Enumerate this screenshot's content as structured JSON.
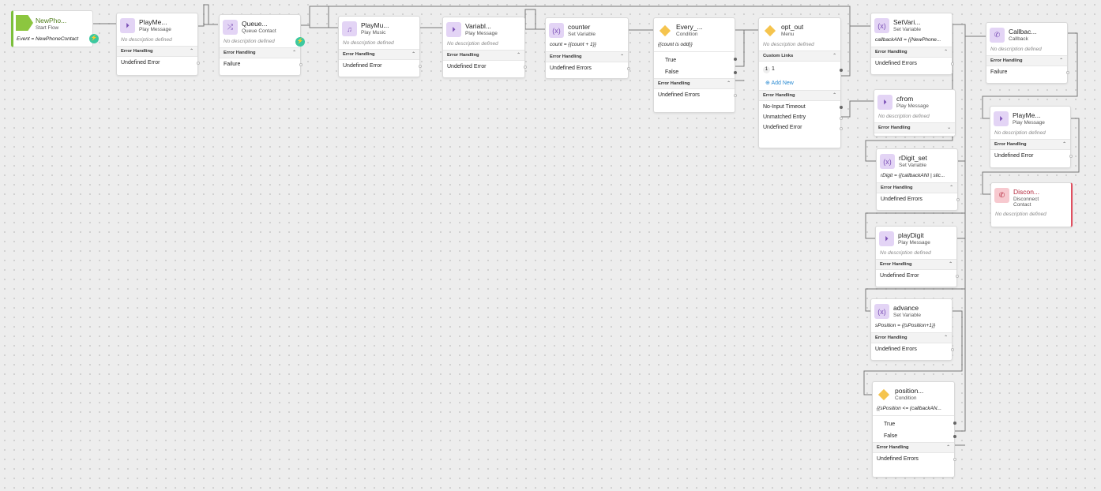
{
  "start": {
    "title": "NewPho...",
    "subtitle": "Start Flow",
    "event": "Event = NewPhoneContact"
  },
  "icons": {
    "play": "play-circle-icon",
    "queue": "shuffle-icon",
    "music": "music-note-icon",
    "variable": "variable-x-icon",
    "condition": "condition-diamond-icon",
    "menu": "menu-list-icon",
    "callback": "phone-callback-icon",
    "disconnect": "phone-disconnect-icon",
    "bolt": "bolt-icon"
  },
  "colors": {
    "start": "#8cc63f",
    "activity": "#e3d4f5",
    "condition": "#f5c44e",
    "disconnect": "#e05060",
    "link": "#2a8bd2"
  },
  "nodes": {
    "play1": {
      "title": "PlayMe...",
      "sub": "Play Message",
      "desc": "No description defined",
      "err": "Error Handling",
      "e1": "Undefined Error"
    },
    "queue": {
      "title": "Queue...",
      "sub": "Queue Contact",
      "desc": "No description defined",
      "err": "Error Handling",
      "e1": "Failure"
    },
    "music": {
      "title": "PlayMu...",
      "sub": "Play Music",
      "desc": "No description defined",
      "err": "Error Handling",
      "e1": "Undefined Error"
    },
    "varmsg": {
      "title": "Variabl...",
      "sub": "Play Message",
      "desc": "No description defined",
      "err": "Error Handling",
      "e1": "Undefined Error"
    },
    "counter": {
      "title": "counter",
      "sub": "Set Variable",
      "expr": "count = {{count + 1}}",
      "err": "Error Handling",
      "e1": "Undefined Errors"
    },
    "every": {
      "title": "Every_...",
      "sub": "Condition",
      "expr": "{{count is odd}}",
      "o1": "True",
      "o2": "False",
      "err": "Error Handling",
      "e1": "Undefined Errors"
    },
    "optout": {
      "title": "opt_out",
      "sub": "Menu",
      "desc": "No description defined",
      "links": "Custom Links",
      "link_key": "1",
      "link_val": "1",
      "add": "Add New",
      "err": "Error Handling",
      "e1": "No-Input Timeout",
      "e2": "Unmatched Entry",
      "e3": "Undefined Error"
    },
    "setvar": {
      "title": "SetVari...",
      "sub": "Set Variable",
      "expr": "callbackANI = {{NewPhone...",
      "err": "Error Handling",
      "e1": "Undefined Errors"
    },
    "cfrom": {
      "title": "cfrom",
      "sub": "Play Message",
      "desc": "No description defined",
      "err": "Error Handling"
    },
    "rdigit": {
      "title": "rDigit_set",
      "sub": "Set Variable",
      "expr": "rDigit = {{callbackANI | slic...",
      "err": "Error Handling",
      "e1": "Undefined Errors"
    },
    "playdigit": {
      "title": "playDigit",
      "sub": "Play Message",
      "desc": "No description defined",
      "err": "Error Handling",
      "e1": "Undefined Error"
    },
    "advance": {
      "title": "advance",
      "sub": "Set Variable",
      "expr": "sPosition = {{sPosition+1}}",
      "err": "Error Handling",
      "e1": "Undefined Errors"
    },
    "position": {
      "title": "position...",
      "sub": "Condition",
      "expr": "{{sPosition <= (callbackAN...",
      "o1": "True",
      "o2": "False",
      "err": "Error Handling",
      "e1": "Undefined Errors"
    },
    "callback": {
      "title": "Callbac...",
      "sub": "Callback",
      "desc": "No description defined",
      "err": "Error Handling",
      "e1": "Failure"
    },
    "play2": {
      "title": "PlayMe...",
      "sub": "Play Message",
      "desc": "No description defined",
      "err": "Error Handling",
      "e1": "Undefined Error"
    },
    "disc": {
      "title": "Discon...",
      "sub": "Disconnect Contact",
      "desc": "No description defined"
    }
  }
}
